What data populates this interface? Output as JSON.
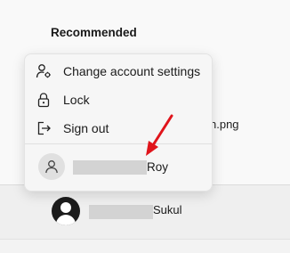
{
  "start_menu": {
    "section_title": "Recommended",
    "partial_file_name": "n.png"
  },
  "account_menu": {
    "items": [
      {
        "label": "Change account settings",
        "icon": "person-gear-icon"
      },
      {
        "label": "Lock",
        "icon": "lock-icon"
      },
      {
        "label": "Sign out",
        "icon": "sign-out-icon"
      }
    ],
    "other_account": {
      "name_suffix": "Roy",
      "icon": "person-icon"
    }
  },
  "taskbar_user": {
    "name_suffix": "Sukul",
    "icon": "person-icon"
  },
  "annotation": {
    "arrow_color": "#e0141b"
  }
}
